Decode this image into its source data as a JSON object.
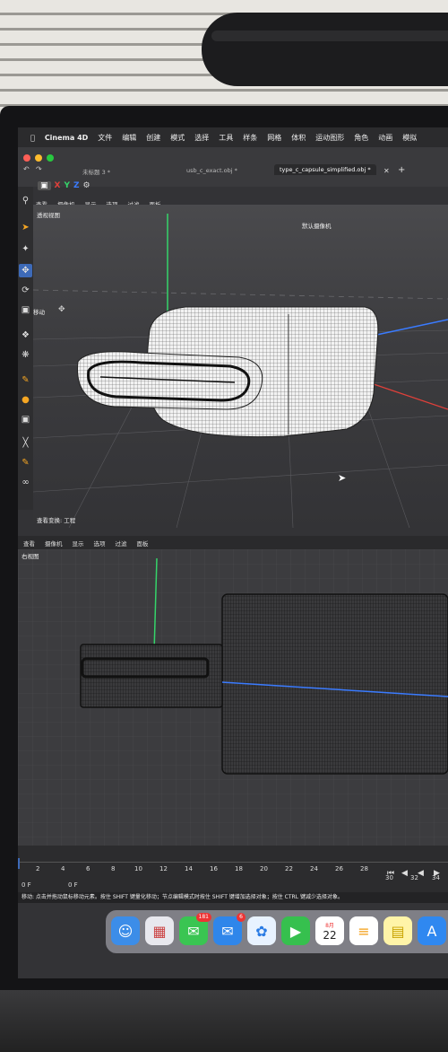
{
  "menubar": {
    "app_name": "Cinema 4D",
    "items": [
      "文件",
      "编辑",
      "创建",
      "模式",
      "选择",
      "工具",
      "样条",
      "网格",
      "体积",
      "运动图形",
      "角色",
      "动画",
      "模拟"
    ]
  },
  "tabs": [
    {
      "label": "未标题 3 *"
    },
    {
      "label": "usb_c_exact.obj *"
    },
    {
      "label": "type_c_capsule_simplified.obj *",
      "active": true
    }
  ],
  "axis_buttons": {
    "x": "X",
    "y": "Y",
    "z": "Z"
  },
  "viewport_top": {
    "menu": [
      "查看",
      "摄像机",
      "显示",
      "选项",
      "过滤",
      "面板"
    ],
    "name": "透视视图",
    "camera": "默认摄像机",
    "move_label": "移动",
    "footer": "查看变换: 工程"
  },
  "viewport_bottom": {
    "menu": [
      "查看",
      "摄像机",
      "显示",
      "选项",
      "过滤",
      "面板"
    ],
    "name": "右视图"
  },
  "timeline": {
    "frames": [
      "0",
      "2",
      "4",
      "6",
      "8",
      "10",
      "12",
      "14",
      "16",
      "18",
      "20",
      "22",
      "24",
      "26",
      "28",
      "30",
      "32",
      "34"
    ],
    "current_frame": "0 F",
    "start_frame": "0 F"
  },
  "status_bar": {
    "text": "移动: 点击并拖动鼠标移动元素。按住 SHIFT 键量化移动；节点编辑模式时按住 SHIFT 键增加选择对象；按住 CTRL 键减少选择对象。"
  },
  "dock": {
    "mail_badge": "181",
    "calendar_month": "8月",
    "calendar_day": "22",
    "app_badge": "6"
  },
  "colors": {
    "x_axis": "#e0403a",
    "y_axis": "#35d46a",
    "z_axis": "#3a7bff",
    "selected_tool": "#3d6ab8"
  }
}
